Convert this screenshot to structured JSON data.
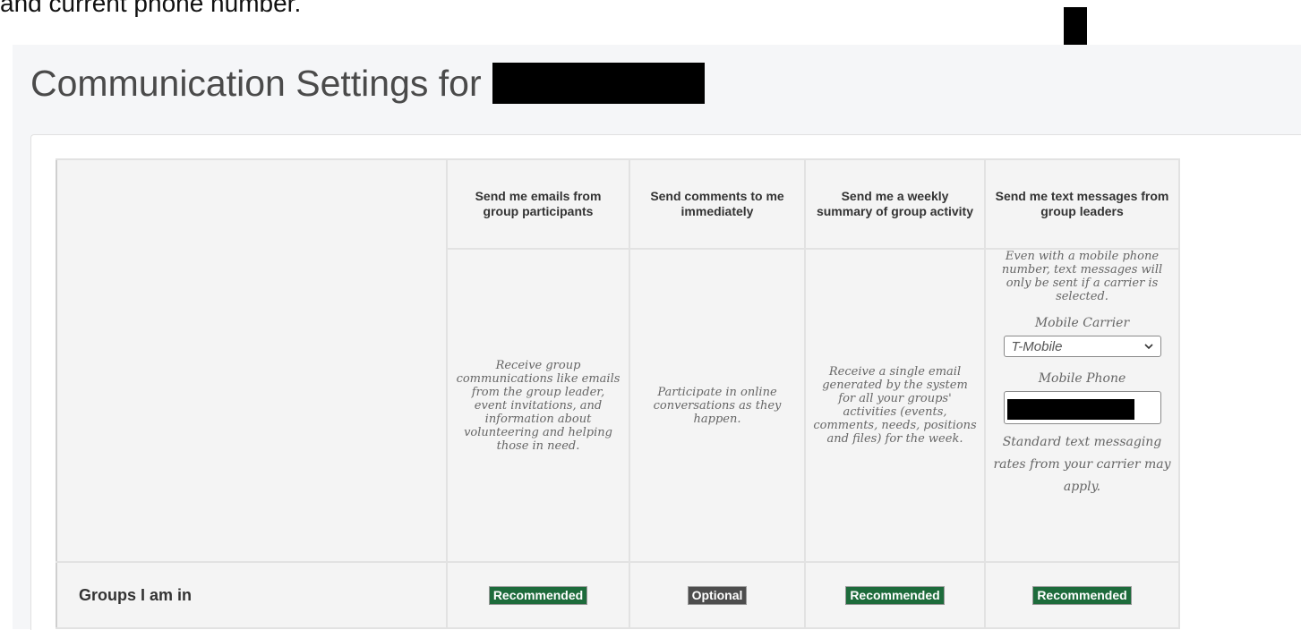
{
  "caption": "and current phone number.",
  "page": {
    "title": "Communication Settings for",
    "name_redacted": true
  },
  "table": {
    "columns": [
      {
        "header": "Send me emails from group participants",
        "description": "Receive group communications like emails from the group leader, event invitations, and information about volunteering and helping those in need.",
        "badge": "Recommended"
      },
      {
        "header": "Send comments to me immediately",
        "description": "Participate in online conversations as they happen.",
        "badge": "Optional"
      },
      {
        "header": "Send me a weekly summary of group activity",
        "description": "Receive a single email generated by the system for all your groups' activities (events, comments, needs, positions and files) for the week.",
        "badge": "Recommended"
      },
      {
        "header": "Send me text messages from group leaders",
        "description": "Even with a mobile phone number, text messages will only be sent if a carrier is selected.",
        "badge": "Recommended"
      }
    ],
    "row_label": "Groups I am in"
  },
  "sms": {
    "carrier_label": "Mobile Carrier",
    "carrier_value": "T-Mobile",
    "phone_label": "Mobile Phone",
    "rates_note": "Standard text messaging rates from your carrier may apply."
  },
  "colors": {
    "recommended": "#1d6b3b",
    "optional": "#4d4d4d",
    "title": "#4a4a4a"
  },
  "icons": {
    "arrow": "down-arrow-icon",
    "dropdown": "chevron-down-icon"
  }
}
